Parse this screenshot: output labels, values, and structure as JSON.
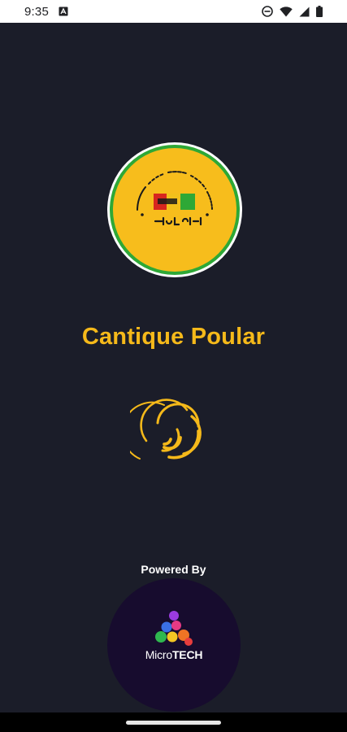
{
  "status_bar": {
    "time": "9:35",
    "icons": [
      "app-notification-icon",
      "do-not-disturb-icon",
      "wifi-icon",
      "signal-icon",
      "battery-icon"
    ]
  },
  "splash": {
    "app_title": "Cantique Poular",
    "loading": true,
    "powered_by_label": "Powered By",
    "sponsor_name_part1": "Micro",
    "sponsor_name_part2": "TECH"
  },
  "colors": {
    "background": "#1b1d29",
    "accent": "#f5b91a",
    "logo_ring": "#2ea836",
    "sponsor_bg": "#170c2e"
  }
}
